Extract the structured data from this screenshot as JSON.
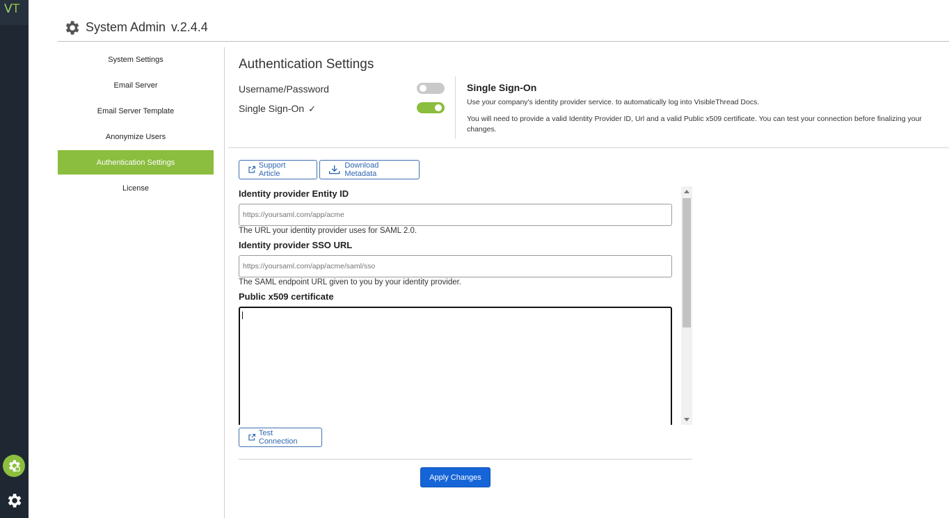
{
  "app": {
    "logo": {
      "v": "V",
      "t": "T"
    },
    "title": "System Admin",
    "version": "v.2.4.4",
    "colors": {
      "accent_green": "#8bbd3e",
      "primary_blue": "#1565d8",
      "sidebar_dark": "#1f2733"
    }
  },
  "leftbar": {
    "icons": [
      "gear-lock-icon",
      "gear-icon"
    ]
  },
  "sidenav": {
    "items": [
      {
        "label": "System Settings"
      },
      {
        "label": "Email Server"
      },
      {
        "label": "Email Server Template"
      },
      {
        "label": "Anonymize Users"
      },
      {
        "label": "Authentication Settings",
        "active": true
      },
      {
        "label": "License"
      }
    ]
  },
  "auth": {
    "title": "Authentication Settings",
    "options": [
      {
        "label": "Username/Password",
        "enabled": false,
        "checkmark": ""
      },
      {
        "label": "Single Sign-On",
        "enabled": true,
        "checkmark": "✓"
      }
    ],
    "sso_info": {
      "heading": "Single Sign-On",
      "line1": "Use your company's identity provider service. to automatically log into VisibleThread Docs.",
      "line2": "You will need to provide a valid Identity Provider ID, Url and a valid Public x509 certificate. You can test your connection before finalizing your changes."
    },
    "buttons": {
      "support": "Support Article",
      "download": "Download Metadata",
      "test": "Test Connection",
      "apply": "Apply Changes"
    },
    "fields": {
      "entity_id": {
        "label": "Identity provider Entity ID",
        "placeholder": "https://yoursaml.com/app/acme",
        "value": "",
        "help": "The URL your identity provider uses for SAML 2.0."
      },
      "sso_url": {
        "label": "Identity provider SSO URL",
        "placeholder": "https://yoursaml.com/app/acme/saml/sso",
        "value": "",
        "help": "The SAML endpoint URL given to you by your identity provider."
      },
      "certificate": {
        "label": "Public x509 certificate",
        "value": ""
      }
    }
  }
}
